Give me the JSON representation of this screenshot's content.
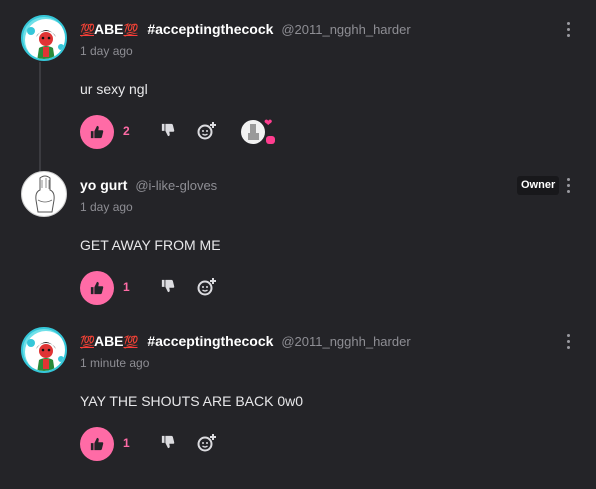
{
  "comments": [
    {
      "badge_left": "💯",
      "name": "ABE",
      "badge_right": "💯",
      "group": "#acceptingthecock",
      "handle": "@2011_ngghh_harder",
      "time": "1 day ago",
      "text": "ur sexy ngl",
      "likes": "2"
    },
    {
      "name": "yo gurt",
      "handle": "@i-like-gloves",
      "role": "Owner",
      "time": "1 day ago",
      "text": "GET AWAY FROM ME",
      "likes": "1"
    },
    {
      "badge_left": "💯",
      "name": "ABE",
      "badge_right": "💯",
      "group": "#acceptingthecock",
      "handle": "@2011_ngghh_harder",
      "time": "1 minute ago",
      "text": "YAY THE SHOUTS ARE BACK 0w0",
      "likes": "1"
    }
  ],
  "colors": {
    "background": "#242428",
    "like_accent": "#ff6ba6",
    "muted_text": "#8e8e94"
  },
  "icons": [
    "thumbs-up-icon",
    "thumbs-down-icon",
    "add-reaction-icon",
    "more-options-icon"
  ]
}
